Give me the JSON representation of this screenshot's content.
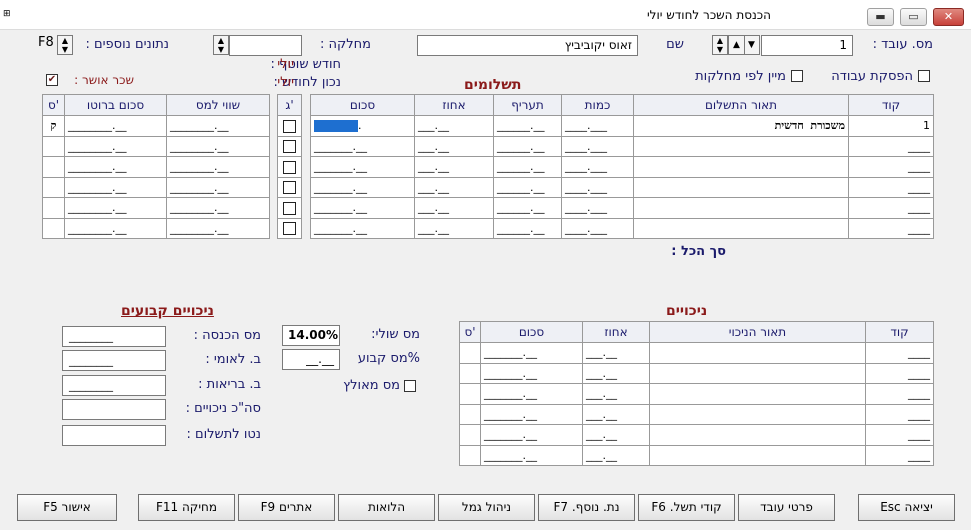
{
  "window": {
    "title": "הכנסת השכר לחודש יולי",
    "minimize": "▬",
    "maximize": "▭",
    "close": "✕"
  },
  "header": {
    "employee_no_label": "מס. עובד :",
    "employee_no_value": "1",
    "name_label": "שם",
    "name_value": "זאוס יקוביביץ",
    "department_label": "מחלקה :",
    "department_value": "",
    "extra_data_label": "נתונים נוספים :",
    "f8_label": "F8",
    "current_month_label": "חודש שוטף :",
    "current_month_value": "יולי",
    "valid_month_label": "נכון לחודש :",
    "valid_month_value": "יולי",
    "approval_label": "שכר אושר :",
    "approval_checked": true,
    "stop_work_label": "הפסקת עבודה",
    "sort_by_dept_label": "מיין לפי מחלקות"
  },
  "payments": {
    "title": "תשלומים",
    "columns": [
      "קוד",
      "תאור התשלום",
      "כמות",
      "תעריף",
      "אחוז",
      "סכום",
      "ג'",
      "שווי למס",
      "סכום ברוטו",
      "ס'"
    ],
    "rows": [
      {
        "code": "1",
        "desc": "משכורת חדשית",
        "qty": "____.___",
        "rate": "______.__",
        "pct": "___.__",
        "amount": ".",
        "g": "",
        "tax_value": "________.__",
        "gross": "________.__",
        "s": "ק"
      },
      {
        "code": "____",
        "desc": "",
        "qty": "____.___",
        "rate": "______.__",
        "pct": "___.__",
        "amount": "_______.__",
        "g": "",
        "tax_value": "________.__",
        "gross": "________.__",
        "s": ""
      },
      {
        "code": "____",
        "desc": "",
        "qty": "____.___",
        "rate": "______.__",
        "pct": "___.__",
        "amount": "_______.__",
        "g": "",
        "tax_value": "________.__",
        "gross": "________.__",
        "s": ""
      },
      {
        "code": "____",
        "desc": "",
        "qty": "____.___",
        "rate": "______.__",
        "pct": "___.__",
        "amount": "_______.__",
        "g": "",
        "tax_value": "________.__",
        "gross": "________.__",
        "s": ""
      },
      {
        "code": "____",
        "desc": "",
        "qty": "____.___",
        "rate": "______.__",
        "pct": "___.__",
        "amount": "_______.__",
        "g": "",
        "tax_value": "________.__",
        "gross": "________.__",
        "s": ""
      },
      {
        "code": "____",
        "desc": "",
        "qty": "____.___",
        "rate": "______.__",
        "pct": "___.__",
        "amount": "_______.__",
        "g": "",
        "tax_value": "________.__",
        "gross": "________.__",
        "s": ""
      }
    ],
    "total_label": "סך הכל :"
  },
  "deductions": {
    "title": "ניכויים",
    "columns": [
      "קוד",
      "תאור הניכוי",
      "אחוז",
      "סכום",
      "ס'"
    ],
    "rows": [
      {
        "code": "____",
        "desc": "",
        "pct": "___.__",
        "amount": "_______.__",
        "s": ""
      },
      {
        "code": "____",
        "desc": "",
        "pct": "___.__",
        "amount": "_______.__",
        "s": ""
      },
      {
        "code": "____",
        "desc": "",
        "pct": "___.__",
        "amount": "_______.__",
        "s": ""
      },
      {
        "code": "____",
        "desc": "",
        "pct": "___.__",
        "amount": "_______.__",
        "s": ""
      },
      {
        "code": "____",
        "desc": "",
        "pct": "___.__",
        "amount": "_______.__",
        "s": ""
      },
      {
        "code": "____",
        "desc": "",
        "pct": "___.__",
        "amount": "_______.__",
        "s": ""
      }
    ]
  },
  "tax": {
    "marginal_label": "מס שולי:",
    "marginal_value": "14.00%",
    "fixed_label": "%מס קבוע",
    "fixed_value": "__.__",
    "nationalized_label": "מס מאולץ"
  },
  "fixed_deductions": {
    "title": "ניכויים קבועים",
    "items": [
      {
        "label": "מס הכנסה :",
        "value": "________"
      },
      {
        "label": "ב. לאומי :",
        "value": "________"
      },
      {
        "label": "ב. בריאות :",
        "value": "________"
      },
      {
        "label": "סה\"כ ניכויים :",
        "value": ""
      },
      {
        "label": "נטו לתשלום :",
        "value": ""
      }
    ]
  },
  "buttons": {
    "exit": "יציאה Esc",
    "employee_details": "פרטי עובד",
    "payment_codes": "קודי תשל. F6",
    "extra_data": "נת. נוסף. F7",
    "camel_mgmt": "ניהול גמל",
    "loans": "הלואות",
    "alerts": "אתרים F9",
    "delete": "מחיקה F11",
    "confirm": "אישור F5"
  }
}
